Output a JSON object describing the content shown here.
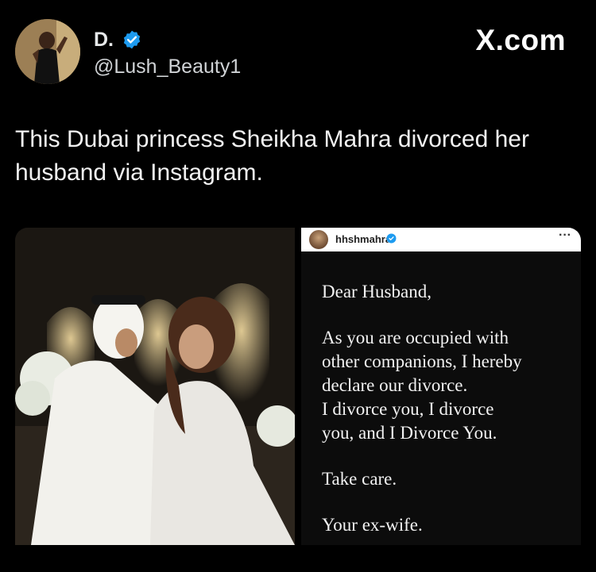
{
  "author": {
    "display_name": "D.",
    "handle": "@Lush_Beauty1",
    "verified_icon": "verified-badge-icon",
    "accent_color": "#1d9bf0"
  },
  "brand": "X.com",
  "tweet": {
    "text": "This Dubai princess Sheikha Mahra divorced  her\nhusband via Instagram."
  },
  "instagram_post": {
    "username": "hhshmahra",
    "more_label": "···",
    "letter": {
      "salutation": "Dear Husband,",
      "body": "As you are occupied with\nother companions, I hereby\ndeclare our divorce.\nI divorce you, I divorce\nyou, and I Divorce You.",
      "closing": "Take care.",
      "signature": "Your ex-wife."
    }
  }
}
